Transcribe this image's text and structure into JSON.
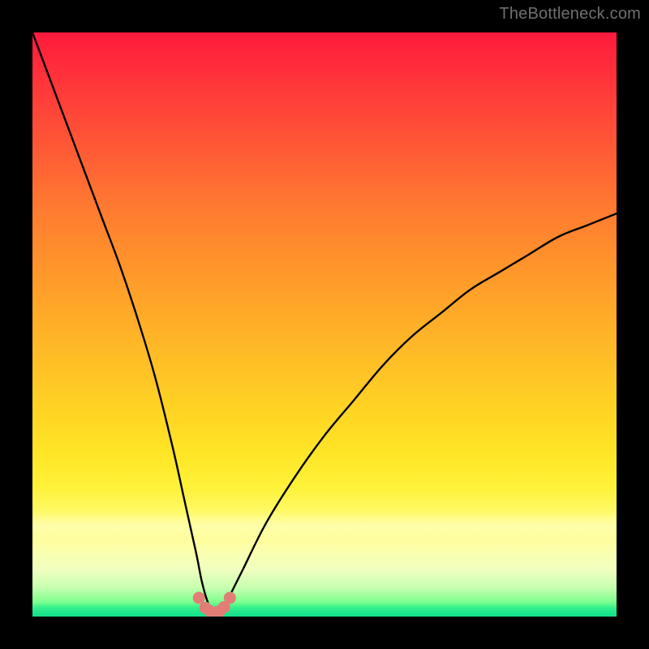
{
  "watermark": {
    "text": "TheBottleneck.com"
  },
  "colors": {
    "frame": "#000000",
    "gradient_top": "#ff1a3d",
    "gradient_mid": "#ffd224",
    "gradient_bottom": "#16df8a",
    "curve": "#000000",
    "dots": "#e27d76"
  },
  "chart_data": {
    "type": "line",
    "title": "",
    "xlabel": "",
    "ylabel": "",
    "xlim": [
      0,
      100
    ],
    "ylim": [
      0,
      100
    ],
    "notes": "V-shaped bottleneck curve overlaid on a vertical heat gradient (red→yellow→green). Minimum (best/green zone) occurs near x≈31 where y≈0. Left branch falls steeply from y≈100 at x=0; right branch rises with decreasing slope toward y≈70 at x=100. A cluster of salmon dots marks the near-minimum region.",
    "series": [
      {
        "name": "bottleneck-curve",
        "x": [
          0,
          3,
          6,
          9,
          12,
          15,
          18,
          21,
          24,
          26,
          28,
          29,
          30,
          31,
          32,
          33,
          34,
          36,
          40,
          45,
          50,
          55,
          60,
          65,
          70,
          75,
          80,
          85,
          90,
          95,
          100
        ],
        "y": [
          100,
          92,
          84,
          76,
          68,
          60,
          51,
          41,
          29,
          20,
          11,
          6,
          2.5,
          0.6,
          0.6,
          2,
          4,
          8,
          16,
          24,
          31,
          37,
          43,
          48,
          52,
          56,
          59,
          62,
          65,
          67,
          69
        ]
      }
    ],
    "dots": {
      "name": "minimum-region",
      "x": [
        28.5,
        29.6,
        30.4,
        31.2,
        32.0,
        32.8,
        33.8
      ],
      "y": [
        3.2,
        1.5,
        0.9,
        0.7,
        0.9,
        1.6,
        3.2
      ]
    }
  }
}
